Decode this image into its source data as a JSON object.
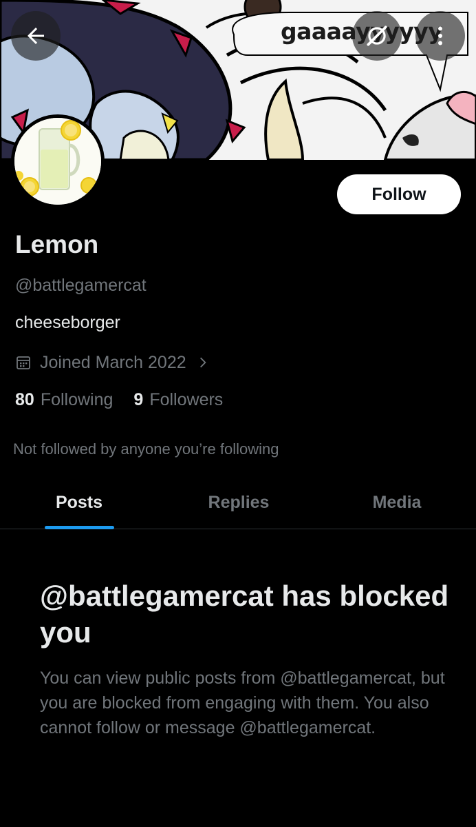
{
  "banner": {
    "speech_text": "gaaaayyyyyy"
  },
  "nav": {
    "back_icon": "arrow-left-icon",
    "grok_icon": "grok-slash-icon",
    "more_icon": "more-vertical-icon"
  },
  "profile": {
    "display_name": "Lemon",
    "handle": "@battlegamercat",
    "bio": "cheeseborger",
    "joined": "Joined March 2022",
    "following_count": "80",
    "following_label": "Following",
    "followers_count": "9",
    "followers_label": "Followers",
    "not_followed_text": "Not followed by anyone you’re following",
    "follow_label": "Follow"
  },
  "tabs": [
    {
      "label": "Posts",
      "active": true
    },
    {
      "label": "Replies",
      "active": false
    },
    {
      "label": "Media",
      "active": false
    }
  ],
  "blocked": {
    "title": "@battlegamercat has blocked you",
    "body": "You can view public posts from @battlegamercat, but you are blocked from engaging with them. You also cannot follow or message @battlegamercat."
  },
  "colors": {
    "background": "#000000",
    "primary_text": "#e7e9ea",
    "secondary_text": "#71767b",
    "accent": "#1d9bf0",
    "follow_button_bg": "#ffffff"
  }
}
